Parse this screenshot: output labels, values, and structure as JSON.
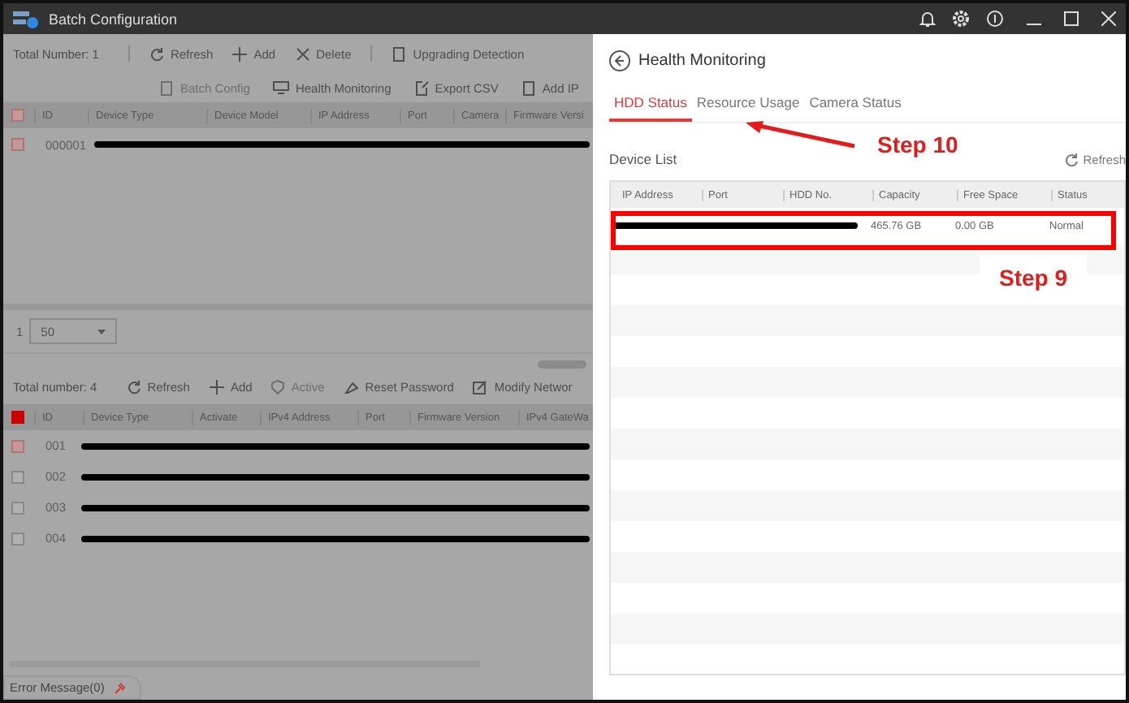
{
  "window": {
    "title": "Batch Configuration"
  },
  "top_panel": {
    "total": "Total Number: 1",
    "toolbar": [
      {
        "label": "Refresh",
        "disabled": false
      },
      {
        "label": "Add",
        "disabled": false
      },
      {
        "label": "Delete",
        "disabled": false
      },
      {
        "label": "Upgrading Detection",
        "disabled": false
      }
    ],
    "toolbar_2": [
      {
        "label": "Batch Config",
        "disabled": true
      },
      {
        "label": "Health Monitoring",
        "disabled": false
      },
      {
        "label": "Export CSV",
        "disabled": false
      },
      {
        "label": "Add IP",
        "disabled": false
      }
    ],
    "select_all_checked": true,
    "columns": [
      "ID",
      "Device Type",
      "Device Model",
      "IP Address",
      "Port",
      "Camera",
      "Firmware Versi"
    ],
    "rows": [
      {
        "id": "000001",
        "checked": true
      }
    ],
    "page": "1",
    "page_size": "50"
  },
  "bottom_panel": {
    "total": "Total number: 4",
    "toolbar": [
      {
        "label": "Refresh",
        "disabled": false
      },
      {
        "label": "Add",
        "disabled": false
      },
      {
        "label": "Active",
        "disabled": true
      },
      {
        "label": "Reset Password",
        "disabled": false
      },
      {
        "label": "Modify Networ",
        "disabled": false
      }
    ],
    "select_all_partial": true,
    "columns": [
      "ID",
      "Device Type",
      "Activate",
      "IPv4 Address",
      "Port",
      "Firmware Version",
      "IPv4 GateWa"
    ],
    "rows": [
      {
        "id": "001",
        "checked": true
      },
      {
        "id": "002",
        "checked": false
      },
      {
        "id": "003",
        "checked": false
      },
      {
        "id": "004",
        "checked": false
      }
    ]
  },
  "error_tab": "Error Message(0)",
  "health_panel": {
    "title": "Health Monitoring",
    "tabs": [
      {
        "label": "HDD Status",
        "selected": true
      },
      {
        "label": "Resource Usage",
        "selected": false
      },
      {
        "label": "Camera Status",
        "selected": false
      }
    ],
    "section": "Device List",
    "refresh": "Refresh",
    "columns": [
      "IP Address",
      "Port",
      "HDD No.",
      "Capacity",
      "Free Space",
      "Status"
    ],
    "rows": [
      {
        "capacity": "465.76 GB",
        "free_space": "0.00 GB",
        "status": "Normal"
      }
    ]
  },
  "annotations": [
    {
      "kind": "arrow",
      "text": "Step 10"
    },
    {
      "kind": "box",
      "text": "Step 9"
    }
  ]
}
